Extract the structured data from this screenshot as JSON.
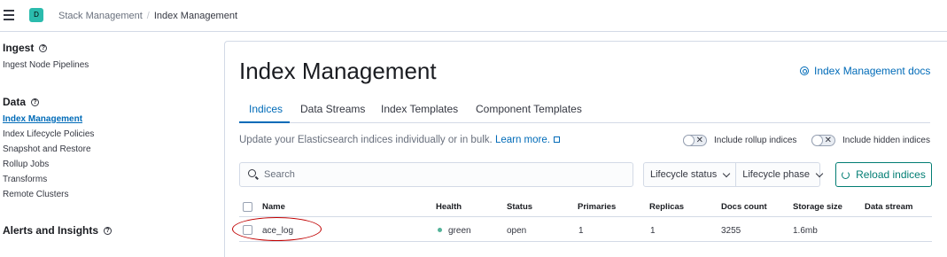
{
  "header": {
    "space_initial": "D",
    "breadcrumbs": [
      "Stack Management",
      "Index Management"
    ]
  },
  "sidebar": {
    "groups": [
      {
        "title": "Ingest",
        "items": [
          {
            "label": "Ingest Node Pipelines"
          }
        ]
      },
      {
        "title": "Data",
        "items": [
          {
            "label": "Index Management",
            "active": true
          },
          {
            "label": "Index Lifecycle Policies"
          },
          {
            "label": "Snapshot and Restore"
          },
          {
            "label": "Rollup Jobs"
          },
          {
            "label": "Transforms"
          },
          {
            "label": "Remote Clusters"
          }
        ]
      },
      {
        "title": "Alerts and Insights",
        "items": []
      }
    ]
  },
  "main": {
    "title": "Index Management",
    "docs_link": "Index Management docs",
    "tabs": [
      {
        "label": "Indices",
        "selected": true
      },
      {
        "label": "Data Streams"
      },
      {
        "label": "Index Templates"
      },
      {
        "label": "Component Templates"
      }
    ],
    "description": "Update your Elasticsearch indices individually or in bulk.",
    "learn_more": "Learn more.",
    "toggles": [
      {
        "label": "Include rollup indices",
        "on": false
      },
      {
        "label": "Include hidden indices",
        "on": false
      }
    ],
    "search": {
      "placeholder": "Search"
    },
    "filters": [
      "Lifecycle status",
      "Lifecycle phase"
    ],
    "reload_label": "Reload indices",
    "table": {
      "columns": [
        "Name",
        "Health",
        "Status",
        "Primaries",
        "Replicas",
        "Docs count",
        "Storage size",
        "Data stream"
      ],
      "rows": [
        {
          "name": "ace_log",
          "health": "green",
          "status": "open",
          "primaries": "1",
          "replicas": "1",
          "docs_count": "3255",
          "storage_size": "1.6mb",
          "data_stream": ""
        }
      ]
    }
  },
  "colors": {
    "accent": "#006bb8",
    "success": "#017d73",
    "health_green": "#54b399",
    "annotation": "#c00000"
  }
}
